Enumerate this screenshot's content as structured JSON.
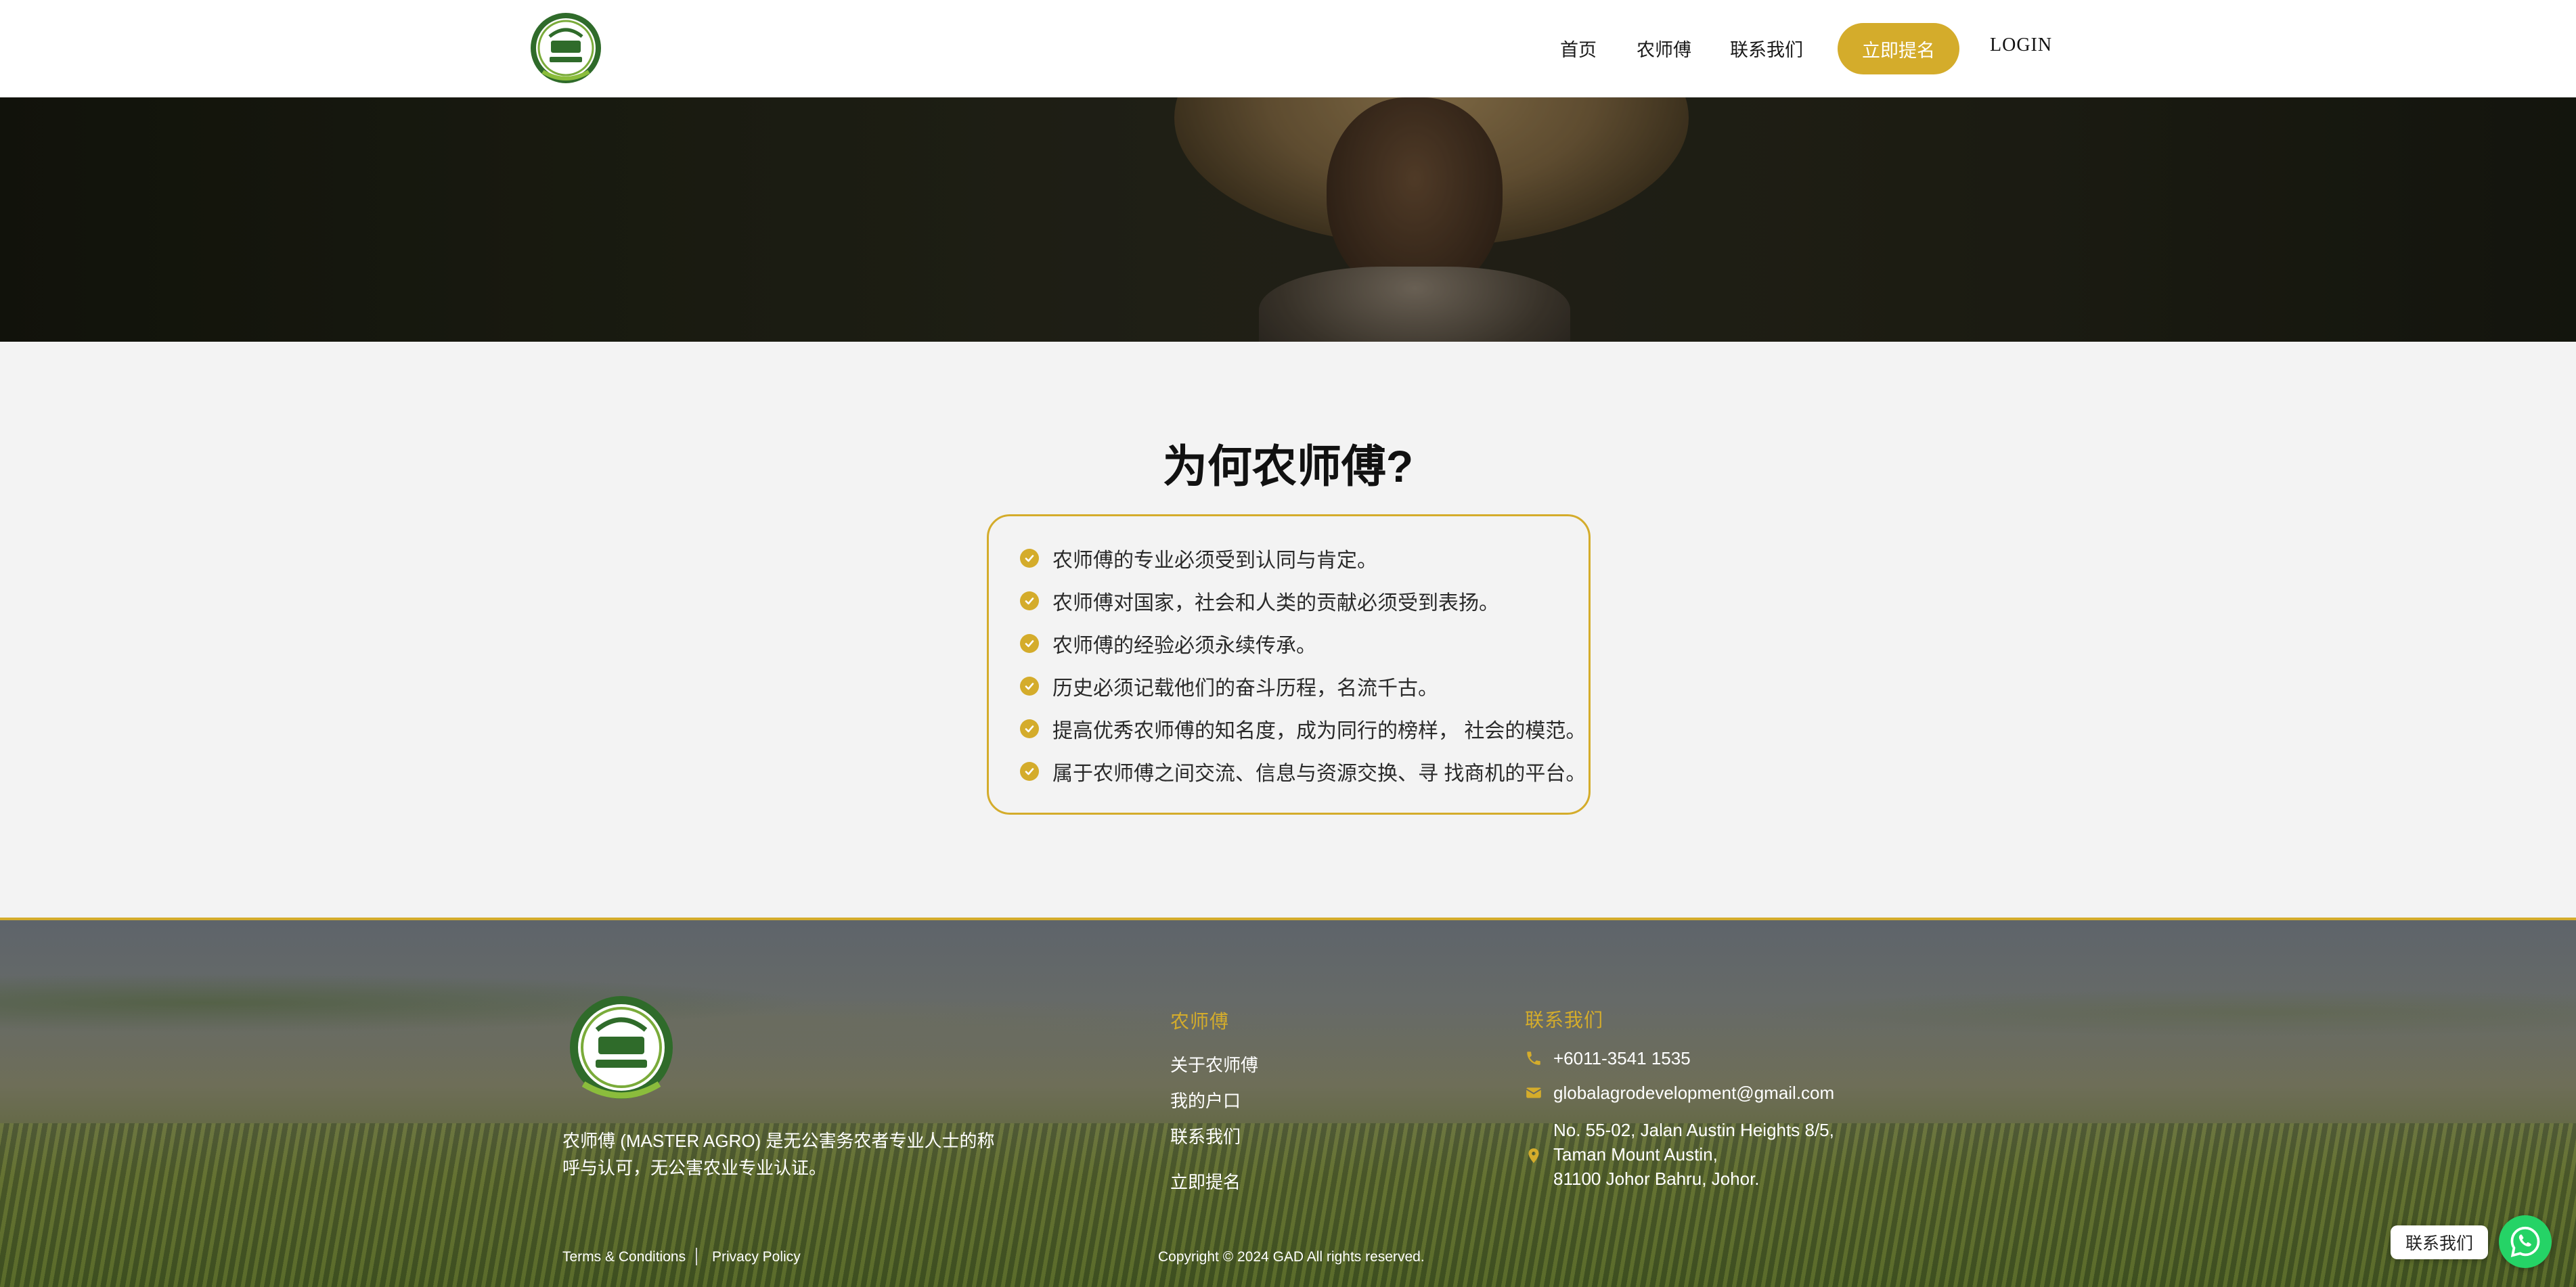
{
  "header": {
    "logo_alt": "Master Agro",
    "nav": {
      "home": "首页",
      "masters": "农师傅",
      "contact": "联系我们",
      "signup": "立即提名",
      "login": "LOGIN"
    }
  },
  "why": {
    "title": "为何农师傅?",
    "items": [
      "农师傅的专业必须受到认同与肯定。",
      "农师傅对国家，社会和人类的贡献必须受到表扬。",
      "农师傅的经验必须永续传承。",
      "历史必须记载他们的奋斗历程，名流千古。",
      "提高优秀农师傅的知名度，成为同行的榜样， 社会的模范。",
      "属于农师傅之间交流、信息与资源交换、寻 找商机的平台。"
    ]
  },
  "footer": {
    "description": "农师傅 (MASTER AGRO) 是无公害务农者专业人士的称呼与认可，无公害农业专业认证。",
    "masters_col": {
      "title": "农师傅",
      "links": [
        "关于农师傅",
        "我的户口",
        "联系我们",
        "立即提名"
      ]
    },
    "contact_col": {
      "title": "联系我们",
      "phone": "+6011-3541 1535",
      "email": "globalagrodevelopment@gmail.com",
      "address": "No. 55-02, Jalan Austin Heights 8/5,\nTaman Mount Austin,\n81100 Johor Bahru, Johor."
    },
    "terms": "Terms & Conditions",
    "privacy": "Privacy Policy",
    "copyright": "Copyright © 2024 GAD All rights reserved."
  },
  "whatsapp": {
    "label": "联系我们"
  },
  "colors": {
    "accent": "#d4ac2b",
    "whatsapp": "#25d366"
  }
}
